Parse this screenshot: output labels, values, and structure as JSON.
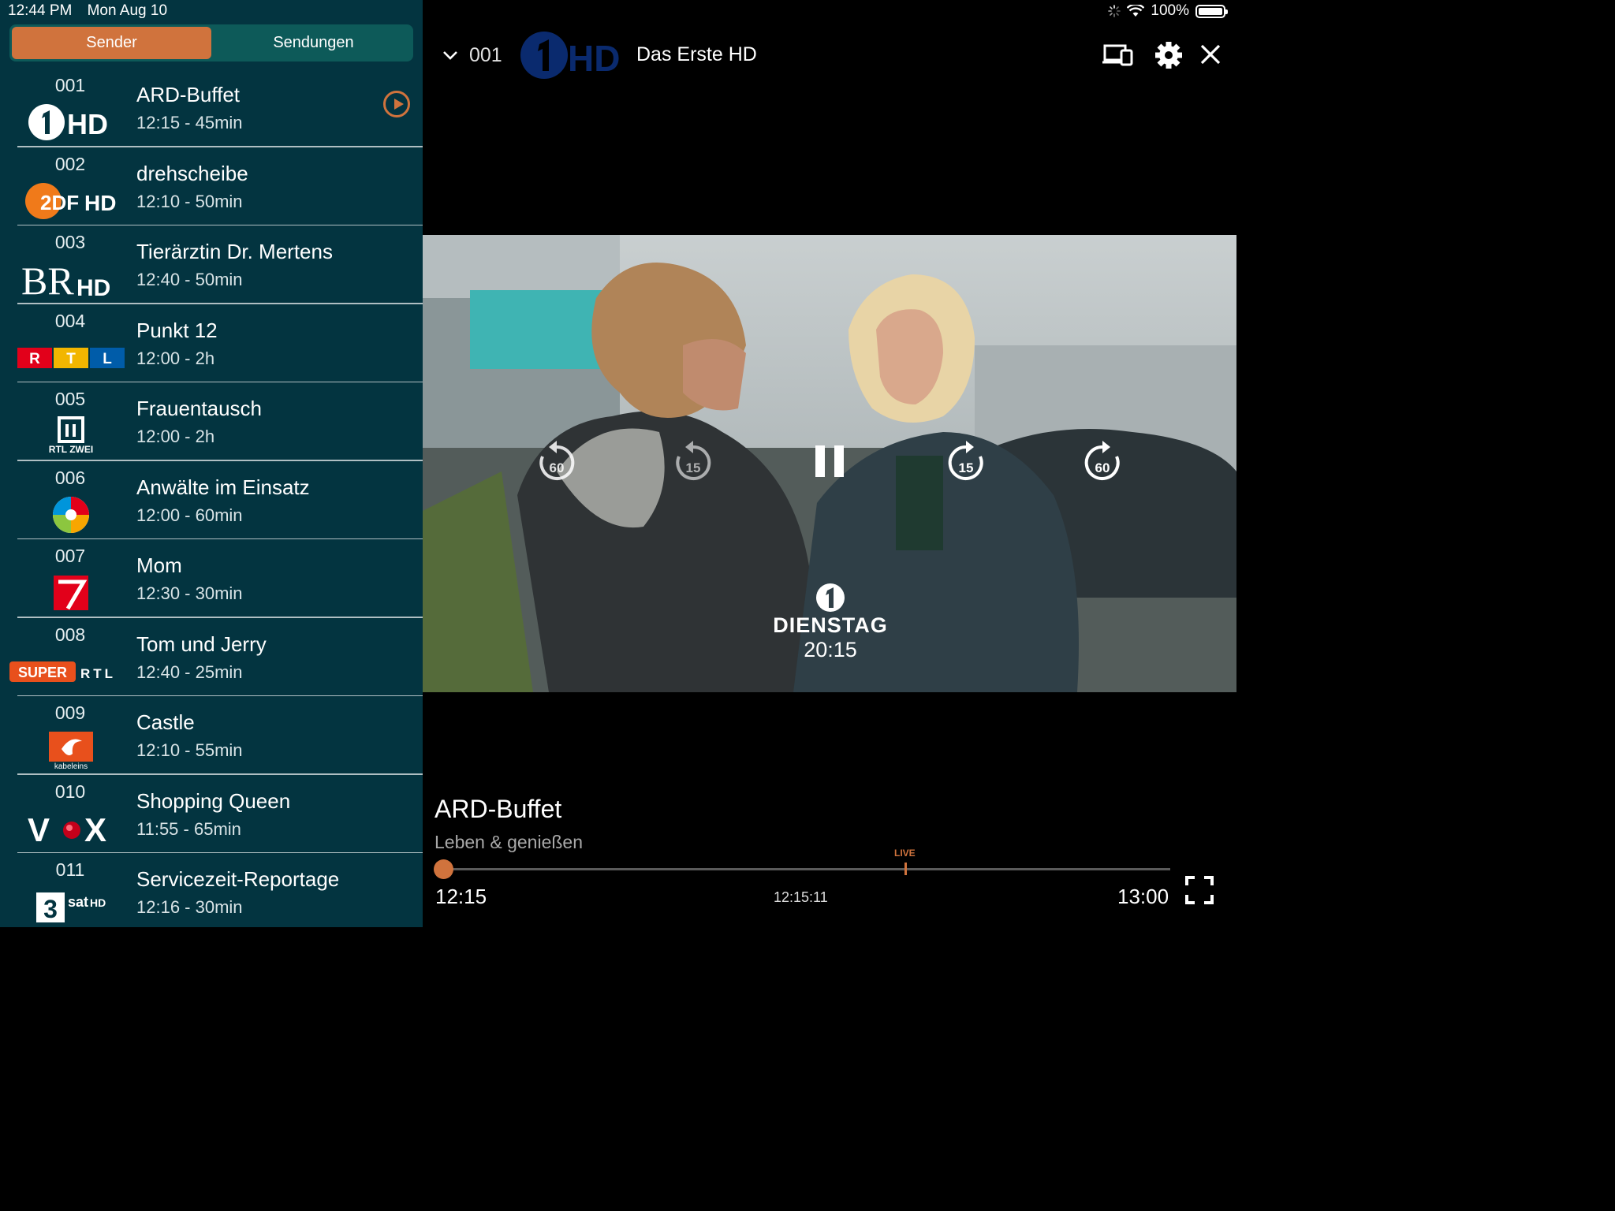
{
  "status_bar": {
    "time": "12:44 PM",
    "date": "Mon Aug 10",
    "battery": "100%",
    "icons": [
      "loading-icon",
      "wifi-icon",
      "battery-icon"
    ]
  },
  "tabs": {
    "sender": "Sender",
    "sendungen": "Sendungen",
    "active": "Sender"
  },
  "channels": [
    {
      "num": "001",
      "title": "ARD-Buffet",
      "time": "12:15 - 45min",
      "logo": "ard-hd-logo"
    },
    {
      "num": "002",
      "title": "drehscheibe",
      "time": "12:10 - 50min",
      "logo": "zdf-hd-logo"
    },
    {
      "num": "003",
      "title": "Tierärztin Dr. Mertens",
      "time": "12:40 - 50min",
      "logo": "br-hd-logo"
    },
    {
      "num": "004",
      "title": "Punkt 12",
      "time": "12:00 - 2h",
      "logo": "rtl-logo"
    },
    {
      "num": "005",
      "title": "Frauentausch",
      "time": "12:00 - 2h",
      "logo": "rtlzwei-logo"
    },
    {
      "num": "006",
      "title": "Anwälte im Einsatz",
      "time": "12:00 - 60min",
      "logo": "sat1-logo"
    },
    {
      "num": "007",
      "title": "Mom",
      "time": "12:30 - 30min",
      "logo": "prosieben-logo"
    },
    {
      "num": "008",
      "title": "Tom und Jerry",
      "time": "12:40 - 25min",
      "logo": "superrtl-logo"
    },
    {
      "num": "009",
      "title": "Castle",
      "time": "12:10 - 55min",
      "logo": "kabeleins-logo"
    },
    {
      "num": "010",
      "title": "Shopping Queen",
      "time": "11:55 - 65min",
      "logo": "vox-logo"
    },
    {
      "num": "011",
      "title": "Servicezeit-Reportage",
      "time": "12:16 - 30min",
      "logo": "3sat-hd-logo"
    }
  ],
  "logo_text": {
    "ard": "HD",
    "zdf": "2DF",
    "zdf_hd": "HD",
    "br": "BR",
    "br_hd": "HD",
    "rtl": [
      "R",
      "T",
      "L"
    ],
    "rtlzwei": "RTL ZWEI",
    "super": "SUPER",
    "superrtl": "RTL",
    "kabeleins": "kabeleins",
    "vox": [
      "V",
      "X"
    ],
    "sat3": "3",
    "sat3_name": "sat",
    "sat3_hd": "HD"
  },
  "player": {
    "channel_num": "001",
    "channel_logo_text": "HD",
    "channel_name": "Das Erste HD",
    "controls": {
      "rewind60": "60",
      "rewind15": "15",
      "forward15": "15",
      "forward60": "60"
    },
    "watermark": {
      "day": "DIENSTAG",
      "time": "20:15"
    },
    "program_title": "ARD-Buffet",
    "program_subtitle": "Leben & genießen",
    "live_label": "LIVE",
    "start_time": "12:15",
    "current_time": "12:15:11",
    "end_time": "13:00",
    "progress_fraction": 0.0
  },
  "colors": {
    "accent": "#d0733d",
    "sidebar_bg": "#033440",
    "segment_bg": "#0d5a59"
  }
}
